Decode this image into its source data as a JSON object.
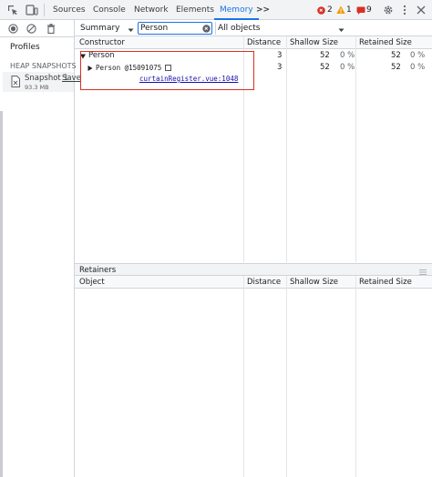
{
  "tabs": [
    {
      "label": "Sources",
      "active": false
    },
    {
      "label": "Console",
      "active": false
    },
    {
      "label": "Network",
      "active": false
    },
    {
      "label": "Elements",
      "active": false
    },
    {
      "label": "Memory",
      "active": true
    }
  ],
  "more_tabs": ">>",
  "status": {
    "errors": "2",
    "warnings": "1",
    "issues": "9"
  },
  "sidebar": {
    "profiles_label": "Profiles",
    "section_heading": "HEAP SNAPSHOTS",
    "snapshot": {
      "name": "Snapshot 1",
      "save_link": "Save",
      "size": "93.3 MB"
    }
  },
  "toolbar": {
    "view_select": "Summary",
    "filter_value": "Person",
    "objects_select": "All objects"
  },
  "constructor_table": {
    "headers": [
      "Constructor",
      "Distance",
      "Shallow Size",
      "Retained Size"
    ],
    "rows": [
      {
        "name": "Person",
        "distance": "3",
        "shallow": "52",
        "shallow_pct": "0 %",
        "retained": "52",
        "retained_pct": "0 %"
      },
      {
        "name": "Person @15091075",
        "distance": "3",
        "shallow": "52",
        "shallow_pct": "0 %",
        "retained": "52",
        "retained_pct": "0 %",
        "link": "curtainRegister.vue:1048"
      }
    ]
  },
  "retainers": {
    "title": "Retainers",
    "headers": [
      "Object",
      "Distance",
      "Shallow Size",
      "Retained Size"
    ]
  },
  "colors": {
    "accent": "#1a73e8",
    "highlight_border": "#d93025",
    "link": "#1a0dab"
  }
}
